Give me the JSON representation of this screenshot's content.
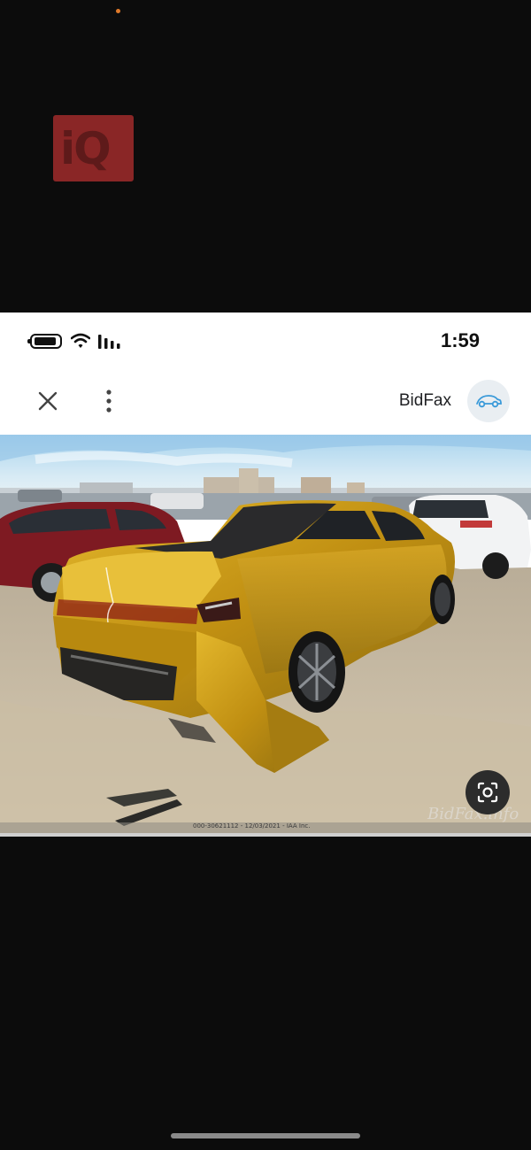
{
  "overlay": {
    "logo_text": "iQ"
  },
  "status_bar": {
    "time": "1:59",
    "icons": [
      "battery-icon",
      "wifi-icon",
      "signal-icon"
    ]
  },
  "toolbar": {
    "close_icon": "close-icon",
    "more_icon": "more-vert-icon",
    "source_name": "BidFax",
    "source_icon": "car-icon"
  },
  "image": {
    "subject": "gold sedan with damaged rear in a lot",
    "caption": "000-30621112 - 12/03/2021 - IAA Inc.",
    "watermark": "BidFax.info",
    "lens_icon": "lens-search-icon"
  },
  "colors": {
    "background": "#0c0c0c",
    "card": "#ffffff",
    "car_gold": "#c99a1a",
    "logo_red": "#8a2626",
    "accent_blue": "#3a9ad9"
  }
}
